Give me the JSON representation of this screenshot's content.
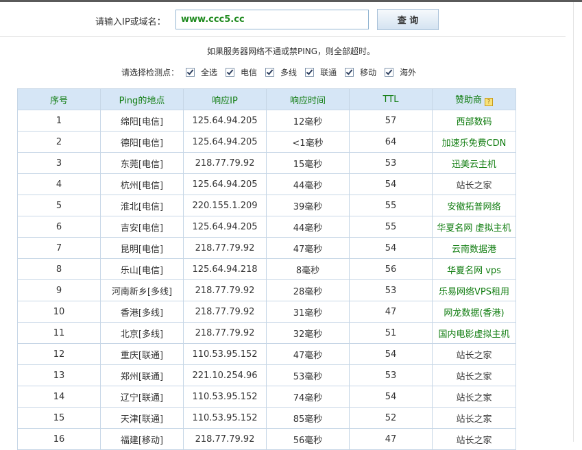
{
  "query": {
    "label": "请输入IP或域名：",
    "value": "www.ccc5.cc",
    "button": "查 询"
  },
  "note": "如果服务器网络不通或禁PING，则全部超时。",
  "filters": {
    "label": "请选择检测点：",
    "options": [
      {
        "label": "全选",
        "checked": true
      },
      {
        "label": "电信",
        "checked": true
      },
      {
        "label": "多线",
        "checked": true
      },
      {
        "label": "联通",
        "checked": true
      },
      {
        "label": "移动",
        "checked": true
      },
      {
        "label": "海外",
        "checked": true
      }
    ]
  },
  "table": {
    "headers": [
      "序号",
      "Ping的地点",
      "响应IP",
      "响应时间",
      "TTL",
      "赞助商"
    ],
    "sponsor_icon": "sponsor-info-icon",
    "rows": [
      [
        "1",
        "绵阳[电信]",
        "125.64.94.205",
        "12毫秒",
        "57",
        "西部数码"
      ],
      [
        "2",
        "德阳[电信]",
        "125.64.94.205",
        "<1毫秒",
        "64",
        "加速乐免费CDN"
      ],
      [
        "3",
        "东莞[电信]",
        "218.77.79.92",
        "15毫秒",
        "53",
        "迅美云主机"
      ],
      [
        "4",
        "杭州[电信]",
        "125.64.94.205",
        "44毫秒",
        "54",
        "站长之家"
      ],
      [
        "5",
        "淮北[电信]",
        "220.155.1.209",
        "39毫秒",
        "55",
        "安徽拓普网络"
      ],
      [
        "6",
        "吉安[电信]",
        "125.64.94.205",
        "44毫秒",
        "55",
        "华夏名网 虚拟主机"
      ],
      [
        "7",
        "昆明[电信]",
        "218.77.79.92",
        "47毫秒",
        "54",
        "云南数据港"
      ],
      [
        "8",
        "乐山[电信]",
        "125.64.94.218",
        "8毫秒",
        "56",
        "华夏名网 vps"
      ],
      [
        "9",
        "河南新乡[多线]",
        "218.77.79.92",
        "28毫秒",
        "53",
        "乐易网络VPS租用"
      ],
      [
        "10",
        "香港[多线]",
        "218.77.79.92",
        "31毫秒",
        "47",
        "网龙数据(香港)"
      ],
      [
        "11",
        "北京[多线]",
        "218.77.79.92",
        "32毫秒",
        "51",
        "国内电影虚拟主机"
      ],
      [
        "12",
        "重庆[联通]",
        "110.53.95.152",
        "47毫秒",
        "54",
        "站长之家"
      ],
      [
        "13",
        "郑州[联通]",
        "221.10.254.96",
        "53毫秒",
        "53",
        "站长之家"
      ],
      [
        "14",
        "辽宁[联通]",
        "110.53.95.152",
        "74毫秒",
        "54",
        "站长之家"
      ],
      [
        "15",
        "天津[联通]",
        "110.53.95.152",
        "85毫秒",
        "52",
        "站长之家"
      ],
      [
        "16",
        "福建[移动]",
        "218.77.79.92",
        "56毫秒",
        "47",
        "站长之家"
      ]
    ],
    "sponsor_link": [
      true,
      true,
      true,
      false,
      true,
      true,
      true,
      true,
      true,
      true,
      true,
      false,
      false,
      false,
      false,
      false
    ]
  },
  "colors": {
    "header_bg": "#d6e6f6",
    "header_text": "#0f7c0f",
    "link_green": "#0f7c0f",
    "border": "#c6d6e6"
  }
}
